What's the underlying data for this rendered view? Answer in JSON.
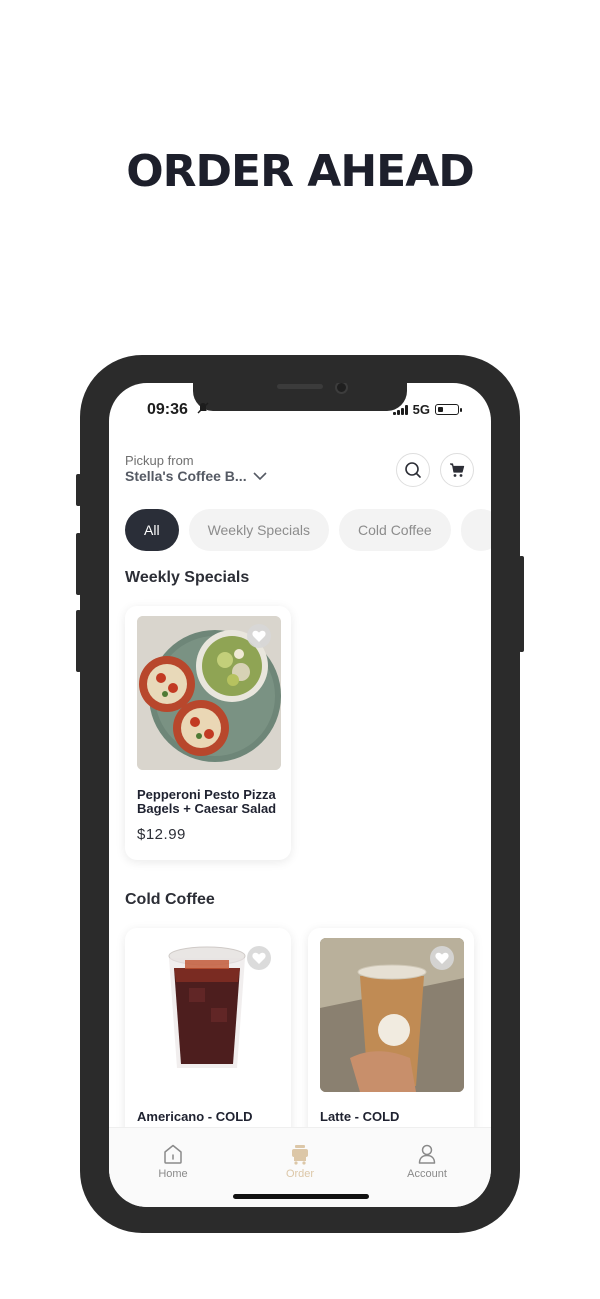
{
  "headline": "ORDER AHEAD",
  "status_bar": {
    "time": "09:36",
    "network": "5G"
  },
  "pickup": {
    "label": "Pickup from",
    "store": "Stella's Coffee B..."
  },
  "icons": {
    "search": "search-icon",
    "cart": "cart-icon",
    "heart": "heart-icon",
    "chevron": "chevron-down-icon"
  },
  "categories": [
    {
      "label": "All",
      "active": true
    },
    {
      "label": "Weekly Specials",
      "active": false
    },
    {
      "label": "Cold Coffee",
      "active": false
    }
  ],
  "sections": {
    "weekly": {
      "title": "Weekly Specials",
      "items": [
        {
          "name_line1": "Pepperoni Pesto Pizza",
          "name_line2": "Bagels + Caesar Salad",
          "price": "$12.99"
        }
      ]
    },
    "cold": {
      "title": "Cold Coffee",
      "items": [
        {
          "name": "Americano - COLD"
        },
        {
          "name": "Latte - COLD"
        }
      ]
    }
  },
  "nav": [
    {
      "label": "Home",
      "icon": "home-icon",
      "active": false
    },
    {
      "label": "Order",
      "icon": "order-icon",
      "active": true
    },
    {
      "label": "Account",
      "icon": "account-icon",
      "active": false
    }
  ],
  "colors": {
    "accent": "#dcc7a8",
    "chip_active": "#2a2e38",
    "frame": "#2b2b2b"
  }
}
